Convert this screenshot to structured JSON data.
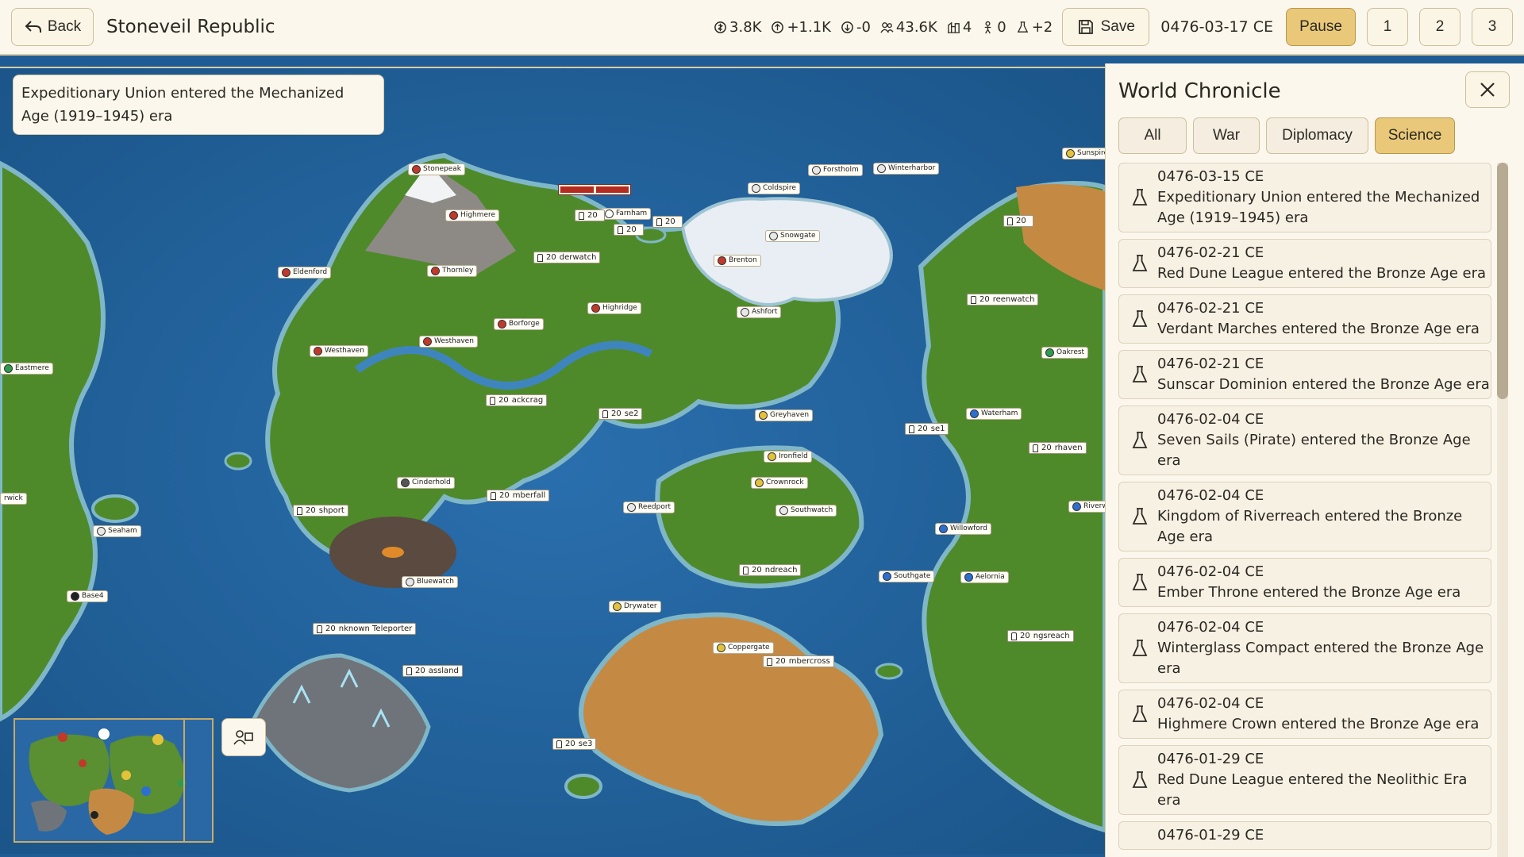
{
  "topbar": {
    "back_label": "Back",
    "civ_name": "Stoneveil Republic",
    "stats": [
      {
        "icon": "gold-coin-icon",
        "value": "3.8K"
      },
      {
        "icon": "income-icon",
        "value": "+1.1K"
      },
      {
        "icon": "upkeep-icon",
        "value": "-0"
      },
      {
        "icon": "population-icon",
        "value": "43.6K"
      },
      {
        "icon": "city-icon",
        "value": "4"
      },
      {
        "icon": "unit-icon",
        "value": "0"
      },
      {
        "icon": "science-flask-icon",
        "value": "+2"
      }
    ],
    "save_label": "Save",
    "date": "0476-03-17 CE",
    "pause_label": "Pause",
    "speeds": [
      "1",
      "2",
      "3"
    ]
  },
  "notification": "Expeditionary Union entered the Mechanized Age (1919–1945) era",
  "map": {
    "cities": [
      "Stonepeak",
      "Highmere",
      "Farnham",
      "Eldenford",
      "Thornley",
      "Westhaven",
      "Westhaven",
      "Borforge",
      "Highridge",
      "Brenton",
      "Ashfort",
      "Coldspire",
      "Forstholm",
      "Winterharbor",
      "Snowgate",
      "Sunspire",
      "Eastmere",
      "Greyhaven",
      "Ironfield",
      "Crownrock",
      "Southwatch",
      "Cinderhold",
      "Reedport",
      "Seaham",
      "Base4",
      "Bluewatch",
      "Drywater",
      "Coppergate",
      "Waterham",
      "Willowford",
      "Southgate",
      "Aelornia",
      "Oakrest",
      "Riverwe",
      "rwick"
    ],
    "units": [
      {
        "count": "20",
        "label": ""
      },
      {
        "count": "20",
        "label": ""
      },
      {
        "count": "20",
        "label": ""
      },
      {
        "count": "20",
        "label": "derwatch"
      },
      {
        "count": "20",
        "label": "ackcrag"
      },
      {
        "count": "20",
        "label": "se2"
      },
      {
        "count": "20",
        "label": "mberfall"
      },
      {
        "count": "20",
        "label": "shport"
      },
      {
        "count": "20",
        "label": "nknown Teleporter"
      },
      {
        "count": "20",
        "label": "assland"
      },
      {
        "count": "20",
        "label": "se3"
      },
      {
        "count": "20",
        "label": "ndreach"
      },
      {
        "count": "20",
        "label": "mbercross"
      },
      {
        "count": "20",
        "label": "reenwatch"
      },
      {
        "count": "20",
        "label": "se1"
      },
      {
        "count": "20",
        "label": "rhaven"
      },
      {
        "count": "20",
        "label": "ngsreach"
      },
      {
        "count": "20",
        "label": ""
      }
    ]
  },
  "chronicle": {
    "title": "World Chronicle",
    "tabs": [
      "All",
      "War",
      "Diplomacy",
      "Science"
    ],
    "active_tab": "Science",
    "events": [
      {
        "date": "0476-03-15 CE",
        "text": "Expeditionary Union entered the Mechanized Age (1919–1945) era"
      },
      {
        "date": "0476-02-21 CE",
        "text": "Red Dune League entered the Bronze Age era"
      },
      {
        "date": "0476-02-21 CE",
        "text": "Verdant Marches entered the Bronze Age era"
      },
      {
        "date": "0476-02-21 CE",
        "text": "Sunscar Dominion entered the Bronze Age era"
      },
      {
        "date": "0476-02-04 CE",
        "text": "Seven Sails (Pirate) entered the Bronze Age era"
      },
      {
        "date": "0476-02-04 CE",
        "text": "Kingdom of Riverreach entered the Bronze Age era"
      },
      {
        "date": "0476-02-04 CE",
        "text": "Ember Throne entered the Bronze Age era"
      },
      {
        "date": "0476-02-04 CE",
        "text": "Winterglass Compact entered the Bronze Age era"
      },
      {
        "date": "0476-02-04 CE",
        "text": "Highmere Crown entered the Bronze Age era"
      },
      {
        "date": "0476-01-29 CE",
        "text": "Red Dune League entered the Neolithic Era era"
      },
      {
        "date": "0476-01-29 CE",
        "text": ""
      }
    ]
  },
  "colors": {
    "ocean": "#1f5b94",
    "grass": "#4f8a2a",
    "desert": "#c48a44",
    "snow": "#e8eef3",
    "accent": "#e9c979",
    "panel_bg": "#fbf7ec"
  }
}
